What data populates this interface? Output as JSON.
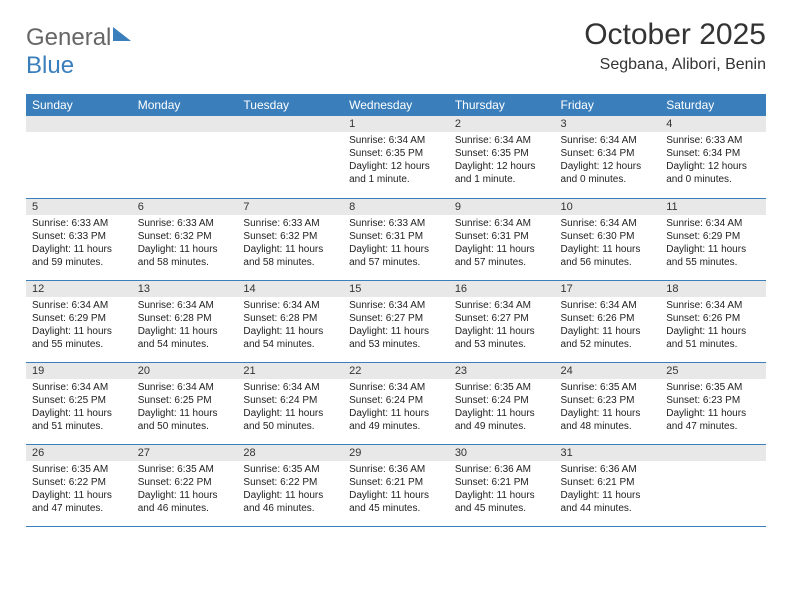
{
  "logo": {
    "word1": "General",
    "word2": "Blue"
  },
  "title": "October 2025",
  "subtitle": "Segbana, Alibori, Benin",
  "dayHeaders": [
    "Sunday",
    "Monday",
    "Tuesday",
    "Wednesday",
    "Thursday",
    "Friday",
    "Saturday"
  ],
  "labels": {
    "sunrise": "Sunrise:",
    "sunset": "Sunset:",
    "daylight": "Daylight:"
  },
  "weeks": [
    [
      null,
      null,
      null,
      {
        "n": "1",
        "sunrise": "6:34 AM",
        "sunset": "6:35 PM",
        "daylight": "12 hours and 1 minute."
      },
      {
        "n": "2",
        "sunrise": "6:34 AM",
        "sunset": "6:35 PM",
        "daylight": "12 hours and 1 minute."
      },
      {
        "n": "3",
        "sunrise": "6:34 AM",
        "sunset": "6:34 PM",
        "daylight": "12 hours and 0 minutes."
      },
      {
        "n": "4",
        "sunrise": "6:33 AM",
        "sunset": "6:34 PM",
        "daylight": "12 hours and 0 minutes."
      }
    ],
    [
      {
        "n": "5",
        "sunrise": "6:33 AM",
        "sunset": "6:33 PM",
        "daylight": "11 hours and 59 minutes."
      },
      {
        "n": "6",
        "sunrise": "6:33 AM",
        "sunset": "6:32 PM",
        "daylight": "11 hours and 58 minutes."
      },
      {
        "n": "7",
        "sunrise": "6:33 AM",
        "sunset": "6:32 PM",
        "daylight": "11 hours and 58 minutes."
      },
      {
        "n": "8",
        "sunrise": "6:33 AM",
        "sunset": "6:31 PM",
        "daylight": "11 hours and 57 minutes."
      },
      {
        "n": "9",
        "sunrise": "6:34 AM",
        "sunset": "6:31 PM",
        "daylight": "11 hours and 57 minutes."
      },
      {
        "n": "10",
        "sunrise": "6:34 AM",
        "sunset": "6:30 PM",
        "daylight": "11 hours and 56 minutes."
      },
      {
        "n": "11",
        "sunrise": "6:34 AM",
        "sunset": "6:29 PM",
        "daylight": "11 hours and 55 minutes."
      }
    ],
    [
      {
        "n": "12",
        "sunrise": "6:34 AM",
        "sunset": "6:29 PM",
        "daylight": "11 hours and 55 minutes."
      },
      {
        "n": "13",
        "sunrise": "6:34 AM",
        "sunset": "6:28 PM",
        "daylight": "11 hours and 54 minutes."
      },
      {
        "n": "14",
        "sunrise": "6:34 AM",
        "sunset": "6:28 PM",
        "daylight": "11 hours and 54 minutes."
      },
      {
        "n": "15",
        "sunrise": "6:34 AM",
        "sunset": "6:27 PM",
        "daylight": "11 hours and 53 minutes."
      },
      {
        "n": "16",
        "sunrise": "6:34 AM",
        "sunset": "6:27 PM",
        "daylight": "11 hours and 53 minutes."
      },
      {
        "n": "17",
        "sunrise": "6:34 AM",
        "sunset": "6:26 PM",
        "daylight": "11 hours and 52 minutes."
      },
      {
        "n": "18",
        "sunrise": "6:34 AM",
        "sunset": "6:26 PM",
        "daylight": "11 hours and 51 minutes."
      }
    ],
    [
      {
        "n": "19",
        "sunrise": "6:34 AM",
        "sunset": "6:25 PM",
        "daylight": "11 hours and 51 minutes."
      },
      {
        "n": "20",
        "sunrise": "6:34 AM",
        "sunset": "6:25 PM",
        "daylight": "11 hours and 50 minutes."
      },
      {
        "n": "21",
        "sunrise": "6:34 AM",
        "sunset": "6:24 PM",
        "daylight": "11 hours and 50 minutes."
      },
      {
        "n": "22",
        "sunrise": "6:34 AM",
        "sunset": "6:24 PM",
        "daylight": "11 hours and 49 minutes."
      },
      {
        "n": "23",
        "sunrise": "6:35 AM",
        "sunset": "6:24 PM",
        "daylight": "11 hours and 49 minutes."
      },
      {
        "n": "24",
        "sunrise": "6:35 AM",
        "sunset": "6:23 PM",
        "daylight": "11 hours and 48 minutes."
      },
      {
        "n": "25",
        "sunrise": "6:35 AM",
        "sunset": "6:23 PM",
        "daylight": "11 hours and 47 minutes."
      }
    ],
    [
      {
        "n": "26",
        "sunrise": "6:35 AM",
        "sunset": "6:22 PM",
        "daylight": "11 hours and 47 minutes."
      },
      {
        "n": "27",
        "sunrise": "6:35 AM",
        "sunset": "6:22 PM",
        "daylight": "11 hours and 46 minutes."
      },
      {
        "n": "28",
        "sunrise": "6:35 AM",
        "sunset": "6:22 PM",
        "daylight": "11 hours and 46 minutes."
      },
      {
        "n": "29",
        "sunrise": "6:36 AM",
        "sunset": "6:21 PM",
        "daylight": "11 hours and 45 minutes."
      },
      {
        "n": "30",
        "sunrise": "6:36 AM",
        "sunset": "6:21 PM",
        "daylight": "11 hours and 45 minutes."
      },
      {
        "n": "31",
        "sunrise": "6:36 AM",
        "sunset": "6:21 PM",
        "daylight": "11 hours and 44 minutes."
      },
      null
    ]
  ]
}
